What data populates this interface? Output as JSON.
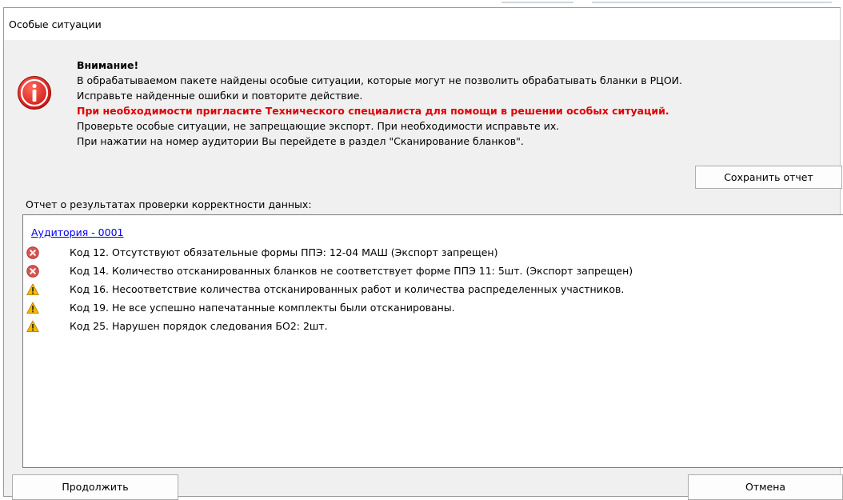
{
  "window": {
    "title": "Особые ситуации"
  },
  "message": {
    "heading": "Внимание!",
    "line1": "В обрабатываемом пакете найдены особые ситуации, которые могут не позволить обрабатывать бланки в РЦОИ.",
    "line2": "Исправьте найденные ошибки и повторите действие.",
    "warning": "При необходимости пригласите Технического специалиста для помощи в решении особых ситуаций.",
    "line3": "Проверьте особые ситуации, не запрещающие экспорт. При необходимости исправьте их.",
    "line4": "При нажатии на номер аудитории Вы перейдете в раздел \"Сканирование бланков\"."
  },
  "buttons": {
    "save_report": "Сохранить отчет",
    "continue": "Продолжить",
    "cancel": "Отмена"
  },
  "report": {
    "label": "Отчет о результатах проверки корректности данных:",
    "auditorium_link": "Аудитория - 0001",
    "items": [
      {
        "icon": "error-icon",
        "text": "Код 12. Отсутствуют обязательные формы ППЭ: 12-04 МАШ (Экспорт запрещен)"
      },
      {
        "icon": "error-icon",
        "text": "Код 14. Количество отсканированных бланков не соответствует форме ППЭ 11: 5шт. (Экспорт запрещен)"
      },
      {
        "icon": "warning-icon",
        "text": "Код 16. Несоответствие количества отсканированных работ и количества распределенных участников."
      },
      {
        "icon": "warning-icon",
        "text": "Код 19. Не все успешно напечатанные комплекты были отсканированы."
      },
      {
        "icon": "warning-icon",
        "text": "Код 25. Нарушен порядок следования БО2: 2шт."
      }
    ]
  },
  "colors": {
    "alert_red": "#e00000",
    "link_blue": "#0000ee",
    "warning_yellow": "#f5b800",
    "dialog_bg": "#f0f0f0"
  }
}
